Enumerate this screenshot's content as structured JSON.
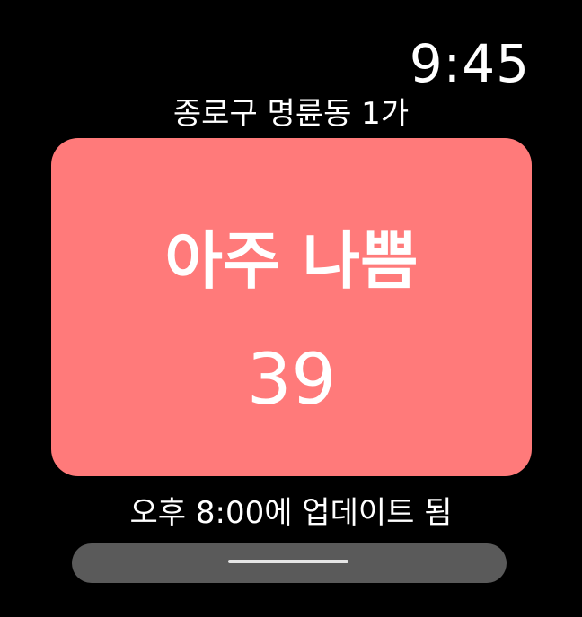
{
  "status_bar": {
    "time": "9:45"
  },
  "location": {
    "name": "종로구 명륜동 1가"
  },
  "air_quality": {
    "status": "아주 나쁨",
    "value": "39",
    "card_color": "#ff7a7a"
  },
  "footer": {
    "updated_text": "오후 8:00에 업데이트 됨"
  }
}
